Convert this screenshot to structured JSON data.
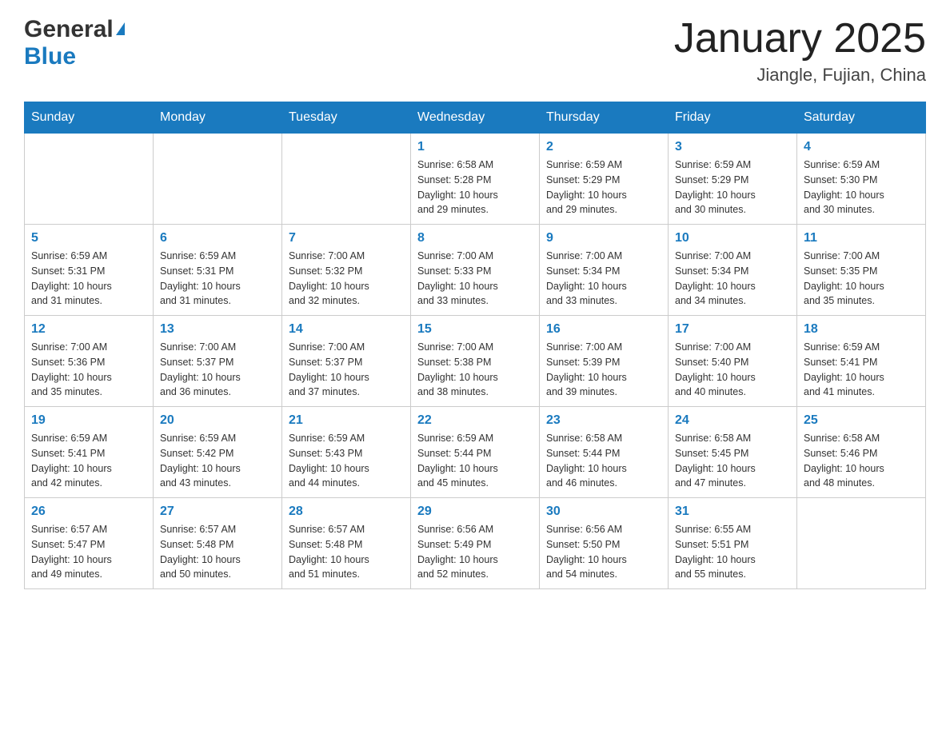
{
  "logo": {
    "general": "General",
    "blue": "Blue"
  },
  "title": "January 2025",
  "subtitle": "Jiangle, Fujian, China",
  "weekdays": [
    "Sunday",
    "Monday",
    "Tuesday",
    "Wednesday",
    "Thursday",
    "Friday",
    "Saturday"
  ],
  "weeks": [
    [
      {
        "day": "",
        "info": ""
      },
      {
        "day": "",
        "info": ""
      },
      {
        "day": "",
        "info": ""
      },
      {
        "day": "1",
        "info": "Sunrise: 6:58 AM\nSunset: 5:28 PM\nDaylight: 10 hours\nand 29 minutes."
      },
      {
        "day": "2",
        "info": "Sunrise: 6:59 AM\nSunset: 5:29 PM\nDaylight: 10 hours\nand 29 minutes."
      },
      {
        "day": "3",
        "info": "Sunrise: 6:59 AM\nSunset: 5:29 PM\nDaylight: 10 hours\nand 30 minutes."
      },
      {
        "day": "4",
        "info": "Sunrise: 6:59 AM\nSunset: 5:30 PM\nDaylight: 10 hours\nand 30 minutes."
      }
    ],
    [
      {
        "day": "5",
        "info": "Sunrise: 6:59 AM\nSunset: 5:31 PM\nDaylight: 10 hours\nand 31 minutes."
      },
      {
        "day": "6",
        "info": "Sunrise: 6:59 AM\nSunset: 5:31 PM\nDaylight: 10 hours\nand 31 minutes."
      },
      {
        "day": "7",
        "info": "Sunrise: 7:00 AM\nSunset: 5:32 PM\nDaylight: 10 hours\nand 32 minutes."
      },
      {
        "day": "8",
        "info": "Sunrise: 7:00 AM\nSunset: 5:33 PM\nDaylight: 10 hours\nand 33 minutes."
      },
      {
        "day": "9",
        "info": "Sunrise: 7:00 AM\nSunset: 5:34 PM\nDaylight: 10 hours\nand 33 minutes."
      },
      {
        "day": "10",
        "info": "Sunrise: 7:00 AM\nSunset: 5:34 PM\nDaylight: 10 hours\nand 34 minutes."
      },
      {
        "day": "11",
        "info": "Sunrise: 7:00 AM\nSunset: 5:35 PM\nDaylight: 10 hours\nand 35 minutes."
      }
    ],
    [
      {
        "day": "12",
        "info": "Sunrise: 7:00 AM\nSunset: 5:36 PM\nDaylight: 10 hours\nand 35 minutes."
      },
      {
        "day": "13",
        "info": "Sunrise: 7:00 AM\nSunset: 5:37 PM\nDaylight: 10 hours\nand 36 minutes."
      },
      {
        "day": "14",
        "info": "Sunrise: 7:00 AM\nSunset: 5:37 PM\nDaylight: 10 hours\nand 37 minutes."
      },
      {
        "day": "15",
        "info": "Sunrise: 7:00 AM\nSunset: 5:38 PM\nDaylight: 10 hours\nand 38 minutes."
      },
      {
        "day": "16",
        "info": "Sunrise: 7:00 AM\nSunset: 5:39 PM\nDaylight: 10 hours\nand 39 minutes."
      },
      {
        "day": "17",
        "info": "Sunrise: 7:00 AM\nSunset: 5:40 PM\nDaylight: 10 hours\nand 40 minutes."
      },
      {
        "day": "18",
        "info": "Sunrise: 6:59 AM\nSunset: 5:41 PM\nDaylight: 10 hours\nand 41 minutes."
      }
    ],
    [
      {
        "day": "19",
        "info": "Sunrise: 6:59 AM\nSunset: 5:41 PM\nDaylight: 10 hours\nand 42 minutes."
      },
      {
        "day": "20",
        "info": "Sunrise: 6:59 AM\nSunset: 5:42 PM\nDaylight: 10 hours\nand 43 minutes."
      },
      {
        "day": "21",
        "info": "Sunrise: 6:59 AM\nSunset: 5:43 PM\nDaylight: 10 hours\nand 44 minutes."
      },
      {
        "day": "22",
        "info": "Sunrise: 6:59 AM\nSunset: 5:44 PM\nDaylight: 10 hours\nand 45 minutes."
      },
      {
        "day": "23",
        "info": "Sunrise: 6:58 AM\nSunset: 5:44 PM\nDaylight: 10 hours\nand 46 minutes."
      },
      {
        "day": "24",
        "info": "Sunrise: 6:58 AM\nSunset: 5:45 PM\nDaylight: 10 hours\nand 47 minutes."
      },
      {
        "day": "25",
        "info": "Sunrise: 6:58 AM\nSunset: 5:46 PM\nDaylight: 10 hours\nand 48 minutes."
      }
    ],
    [
      {
        "day": "26",
        "info": "Sunrise: 6:57 AM\nSunset: 5:47 PM\nDaylight: 10 hours\nand 49 minutes."
      },
      {
        "day": "27",
        "info": "Sunrise: 6:57 AM\nSunset: 5:48 PM\nDaylight: 10 hours\nand 50 minutes."
      },
      {
        "day": "28",
        "info": "Sunrise: 6:57 AM\nSunset: 5:48 PM\nDaylight: 10 hours\nand 51 minutes."
      },
      {
        "day": "29",
        "info": "Sunrise: 6:56 AM\nSunset: 5:49 PM\nDaylight: 10 hours\nand 52 minutes."
      },
      {
        "day": "30",
        "info": "Sunrise: 6:56 AM\nSunset: 5:50 PM\nDaylight: 10 hours\nand 54 minutes."
      },
      {
        "day": "31",
        "info": "Sunrise: 6:55 AM\nSunset: 5:51 PM\nDaylight: 10 hours\nand 55 minutes."
      },
      {
        "day": "",
        "info": ""
      }
    ]
  ]
}
